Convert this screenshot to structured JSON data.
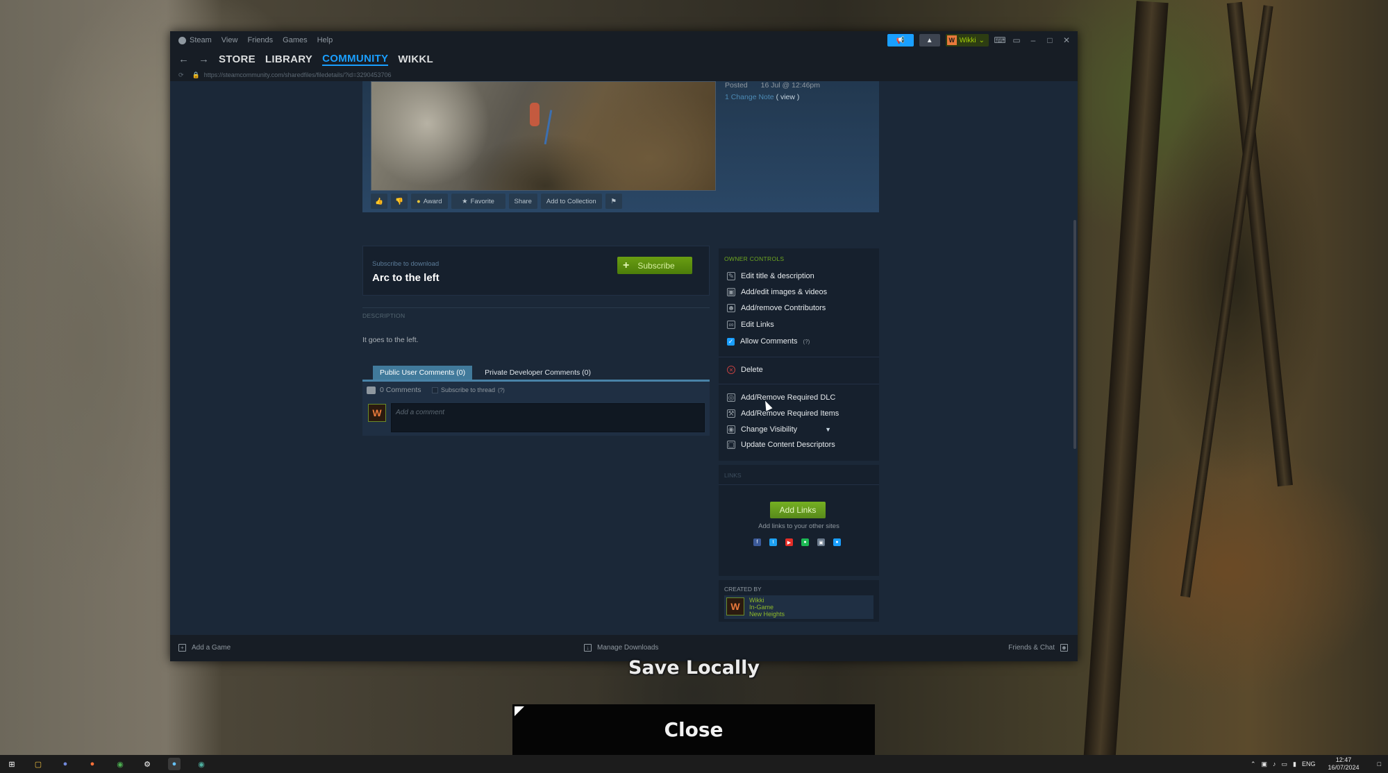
{
  "window": {
    "menu": [
      "Steam",
      "View",
      "Friends",
      "Games",
      "Help"
    ],
    "username": "Wikki",
    "avatar_letter": "W"
  },
  "nav": {
    "tabs": [
      "STORE",
      "LIBRARY",
      "COMMUNITY",
      "WIKKL"
    ],
    "active_tab": "COMMUNITY",
    "url": "https://steamcommunity.com/sharedfiles/filedetails/?id=3290453706"
  },
  "item": {
    "posted_label": "Posted",
    "posted_date": "16 Jul @ 12:46pm",
    "change_note_link": "1 Change Note",
    "change_note_view": "( view )",
    "actions": {
      "award": "Award",
      "favorite": "Favorite",
      "share": "Share",
      "add_to_collection": "Add to Collection"
    },
    "subscribe_hint": "Subscribe to download",
    "title": "Arc to the left",
    "subscribe_label": "Subscribe",
    "description_header": "DESCRIPTION",
    "description": "It goes to the left."
  },
  "comments": {
    "tab_public": "Public User Comments (0)",
    "tab_private": "Private Developer Comments (0)",
    "count": "0 Comments",
    "subscribe_thread": "Subscribe to thread",
    "help": "(?)",
    "placeholder": "Add a comment"
  },
  "owner_controls": {
    "header": "OWNER CONTROLS",
    "edit_title": "Edit title & description",
    "edit_images": "Add/edit images & videos",
    "contributors": "Add/remove Contributors",
    "edit_links": "Edit Links",
    "allow_comments": "Allow Comments",
    "allow_comments_help": "(?)",
    "delete": "Delete",
    "required_dlc": "Add/Remove Required DLC",
    "required_items": "Add/Remove Required Items",
    "change_visibility": "Change Visibility",
    "content_descriptors": "Update Content Descriptors"
  },
  "links": {
    "header": "LINKS",
    "add_links": "Add Links",
    "hint": "Add links to your other sites",
    "social_colors": [
      "#3b5998",
      "#1da1f2",
      "#e52d27",
      "#1db954",
      "#6a7a8c",
      "#1a9fff"
    ]
  },
  "created_by": {
    "header": "CREATED BY",
    "name": "Wikki",
    "status": "In-Game",
    "game": "New Heights"
  },
  "statusbar": {
    "add_game": "Add a Game",
    "manage_downloads": "Manage Downloads",
    "friends_chat": "Friends & Chat"
  },
  "game_overlay": {
    "save_locally": "Save Locally",
    "close": "Close"
  },
  "taskbar": {
    "lang": "ENG",
    "time": "12:47",
    "date": "16/07/2024"
  }
}
